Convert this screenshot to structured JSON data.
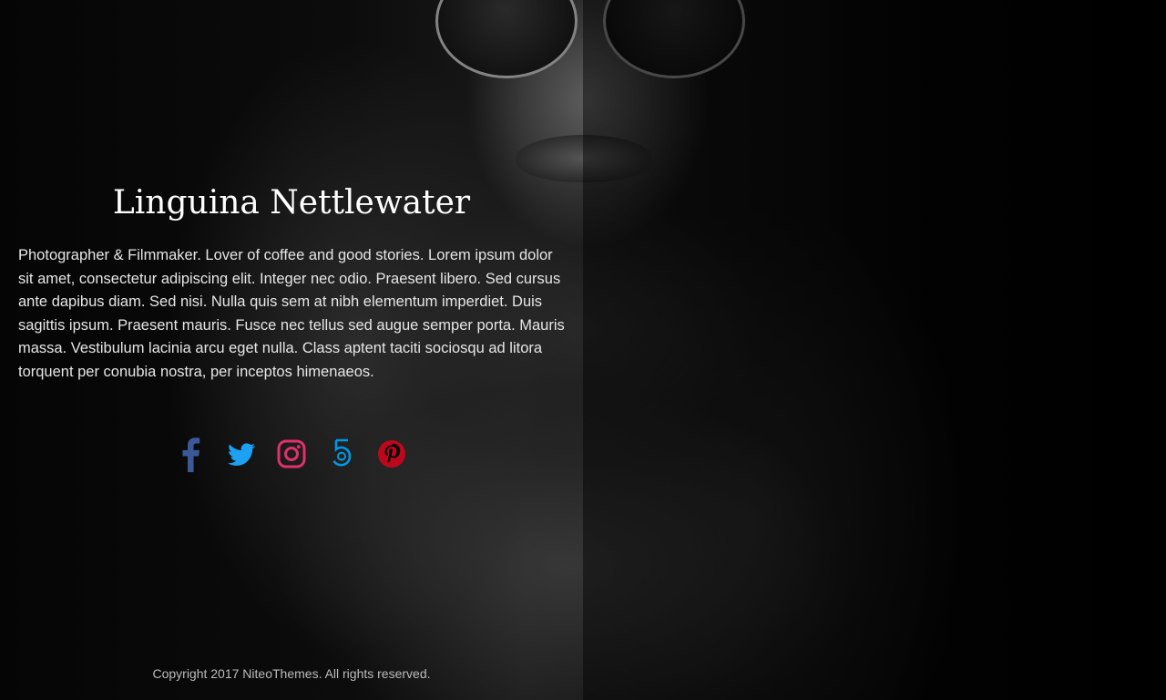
{
  "profile": {
    "name": "Linguina Nettlewater",
    "bio": "Photographer & Filmmaker. Lover of coffee and good stories. Lorem ipsum dolor sit amet, consectetur adipiscing elit. Integer nec odio. Praesent libero. Sed cursus ante dapibus diam. Sed nisi. Nulla quis sem at nibh elementum imperdiet. Duis sagittis ipsum. Praesent mauris. Fusce nec tellus sed augue semper porta. Mauris massa. Vestibulum lacinia arcu eget nulla. Class aptent taciti sociosqu ad litora torquent per conubia nostra, per inceptos himenaeos."
  },
  "social": [
    {
      "icon": "facebook-icon",
      "color": "#3b5998"
    },
    {
      "icon": "twitter-icon",
      "color": "#1da1f2"
    },
    {
      "icon": "instagram-icon",
      "color": "#e1306c"
    },
    {
      "icon": "500px-icon",
      "color": "#0099e5"
    },
    {
      "icon": "pinterest-icon",
      "color": "#bd081c"
    }
  ],
  "footer": {
    "copyright": "Copyright 2017 NiteoThemes. All rights reserved."
  }
}
